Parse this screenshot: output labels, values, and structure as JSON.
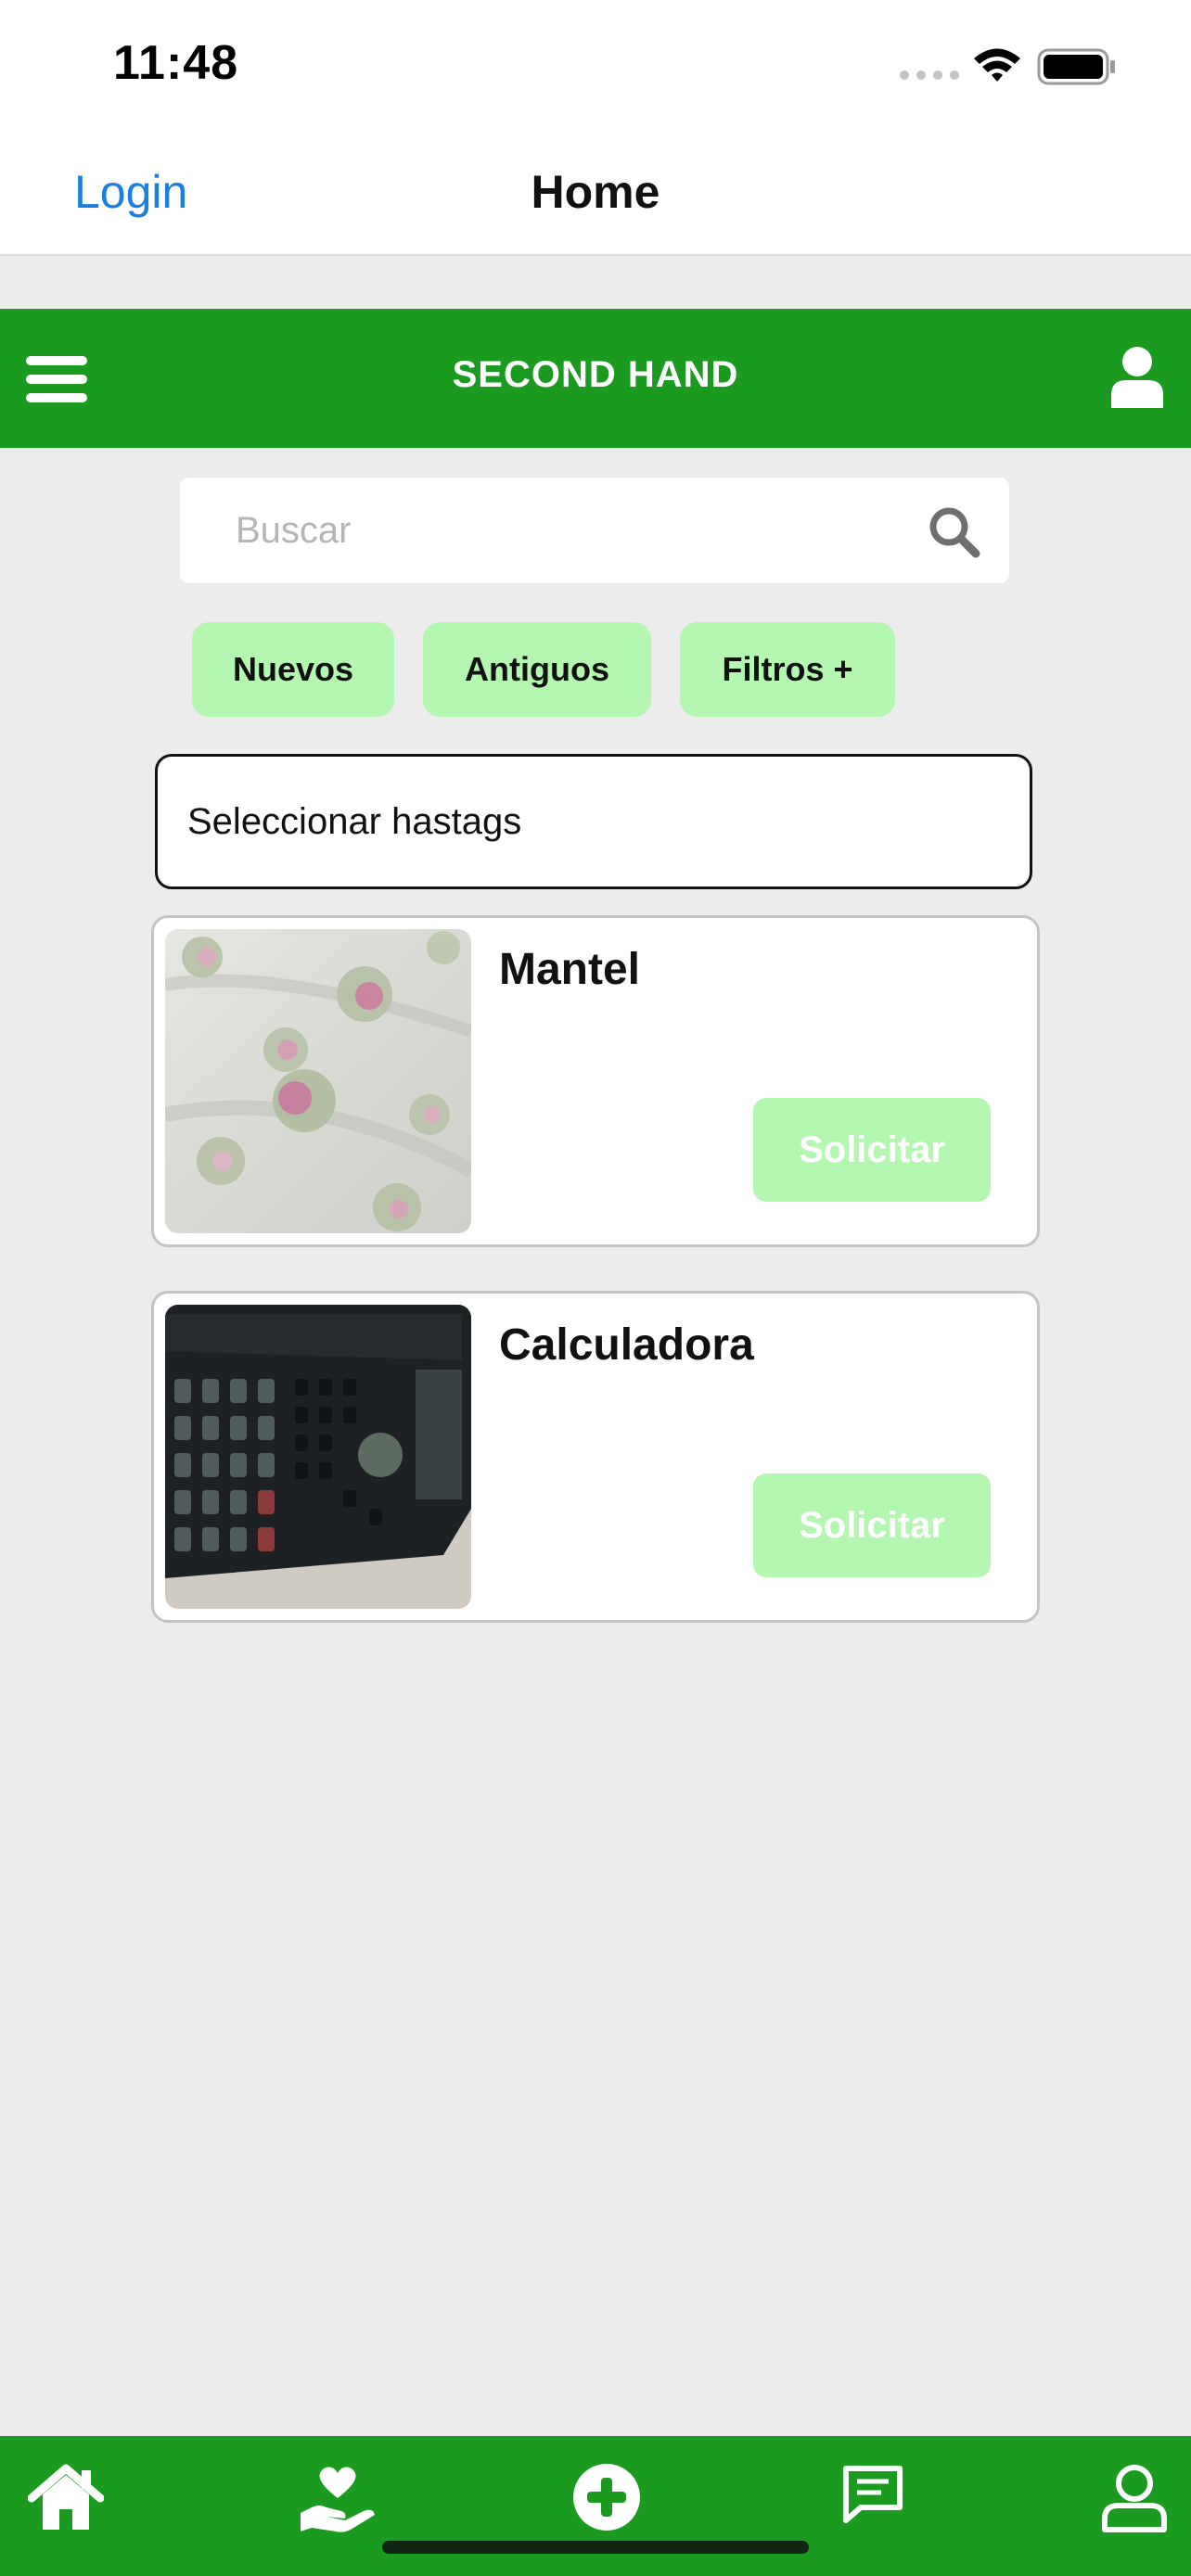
{
  "status_bar": {
    "time": "11:48"
  },
  "nav": {
    "back_label": "Login",
    "title": "Home"
  },
  "header": {
    "title": "SECOND HAND"
  },
  "search": {
    "placeholder": "Buscar"
  },
  "filters": [
    {
      "label": "Nuevos"
    },
    {
      "label": "Antiguos"
    },
    {
      "label": "Filtros +"
    }
  ],
  "hashtags": {
    "label": "Seleccionar hastags"
  },
  "items": [
    {
      "title": "Mantel",
      "button": "Solicitar"
    },
    {
      "title": "Calculadora",
      "button": "Solicitar"
    }
  ],
  "tabs": [
    {
      "icon": "home-icon"
    },
    {
      "icon": "donate-icon"
    },
    {
      "icon": "add-circle-icon"
    },
    {
      "icon": "chat-icon"
    },
    {
      "icon": "profile-icon"
    }
  ],
  "colors": {
    "brand_green": "#1a9b1f",
    "chip_green": "#b4f7b0",
    "link_blue": "#1a7fe0",
    "background": "#ececec"
  }
}
